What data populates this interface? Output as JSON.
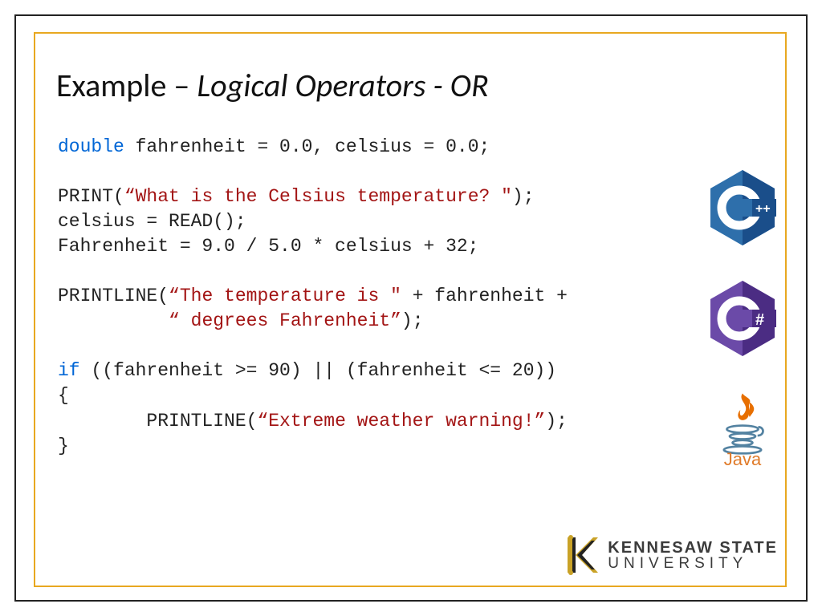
{
  "title": {
    "plain": "Example – ",
    "italic": "Logical Operators - OR"
  },
  "code": {
    "decl_kw": "double",
    "decl_rest": " fahrenheit = 0.0, celsius = 0.0;",
    "print1_open": "PRINT(",
    "print1_str": "“What is the Celsius temperature? \"",
    "print1_close": ");",
    "read_line": "celsius = READ();",
    "calc_line": "Fahrenheit = 9.0 / 5.0 * celsius + 32;",
    "pl1_open": "PRINTLINE(",
    "pl1_str": "“The temperature is \"",
    "pl1_mid": " + fahrenheit +",
    "pl1_indent": "          ",
    "pl1_str2": "“ degrees Fahrenheit”",
    "pl1_close": ");",
    "if_kw": "if",
    "if_cond": " ((fahrenheit >= 90) || (fahrenheit <= 20))",
    "brace_open": "{",
    "body_indent": "        PRINTLINE(",
    "body_str": "“Extreme weather warning!”",
    "body_close": ");",
    "brace_close": "}"
  },
  "logos": {
    "cpp": "C++",
    "csharp": "C#",
    "java": "Java"
  },
  "ksu": {
    "line1": "KENNESAW STATE",
    "line2": "UNIVERSITY"
  }
}
